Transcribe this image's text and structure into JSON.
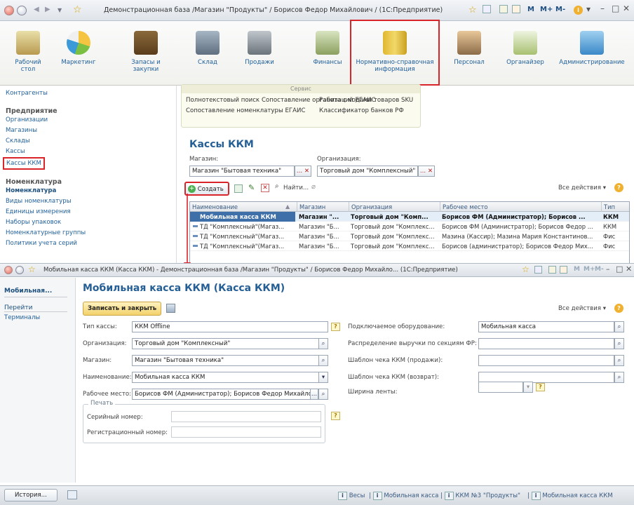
{
  "window": {
    "title": "Демонстрационная база /Магазин \"Продукты\" / Борисов Федор Михайлович /  (1С:Предприятие)",
    "memory_buttons": [
      "M",
      "M+",
      "M-"
    ]
  },
  "sections": [
    {
      "label": "Рабочий стол",
      "icon": "desktop-icon"
    },
    {
      "label": "Маркетинг",
      "icon": "marketing-pie-icon"
    },
    {
      "label": "Запасы и закупки",
      "icon": "warehouse-boxes-icon"
    },
    {
      "label": "Склад",
      "icon": "storage-icon"
    },
    {
      "label": "Продажи",
      "icon": "cash-register-icon"
    },
    {
      "label": "Финансы",
      "icon": "finance-money-icon"
    },
    {
      "label": "Нормативно-справочная информация",
      "icon": "reference-binders-icon"
    },
    {
      "label": "Персонал",
      "icon": "staff-icon"
    },
    {
      "label": "Органайзер",
      "icon": "organizer-checklist-icon"
    },
    {
      "label": "Администрирование",
      "icon": "admin-computer-icon"
    }
  ],
  "nav": {
    "counterparties": "Контрагенты",
    "enterprise_header": "Предприятие",
    "enterprise_items": [
      "Организации",
      "Магазины",
      "Склады",
      "Кассы",
      "Кассы ККМ"
    ],
    "nomenclature_header": "Номенклатура",
    "nomenclature_items": [
      "Номенклатура",
      "Виды номенклатуры",
      "Единицы измерения",
      "Наборы упаковок",
      "Номенклатурные группы",
      "Политики учета серий"
    ]
  },
  "service": {
    "header": "Сервис",
    "col1": [
      "Полнотекстовый поиск",
      "Сопоставление организаций ЕГАИС",
      "Сопоставление номенклатуры ЕГАИС"
    ],
    "col2": [
      "Работа с кодами товаров SKU",
      "Классификатор банков РФ"
    ]
  },
  "kassy": {
    "title": "Кассы ККМ",
    "store_label": "Магазин:",
    "store_value": "Магазин \"Бытовая техника\"",
    "org_label": "Организация:",
    "org_value": "Торговый дом \"Комплексный\"",
    "create_button": "Создать",
    "find_button": "Найти...",
    "all_actions": "Все действия",
    "columns": [
      "Наименование",
      "Магазин",
      "Организация",
      "Рабочее место",
      "Тип"
    ],
    "rows": [
      [
        "Мобильная касса ККМ",
        "Магазин \"...",
        "Торговый дом \"Комп...",
        "Борисов ФМ (Администратор); Борисов ...",
        "ККМ"
      ],
      [
        "ТД \"Комплексный\"(Магаз...",
        "Магазин \"Б...",
        "Торговый дом \"Комплекс...",
        "Борисов ФМ (Администратор); Борисов Федор ...",
        "ККМ"
      ],
      [
        "ТД \"Комплексный\"(Магаз...",
        "Магазин \"Б...",
        "Торговый дом \"Комплекс...",
        "Мазина (Кассир); Мазина Мария Константинов...",
        "Фис"
      ],
      [
        "ТД \"Комплексный\"(Магаз...",
        "Магазин \"Б...",
        "Торговый дом \"Комплекс...",
        "Борисов (администратор); Борисов Федор Мих...",
        "Фис"
      ]
    ]
  },
  "window2": {
    "title": "Мобильная касса ККМ (Касса ККМ) - Демонстрационная база /Магазин \"Продукты\" / Борисов Федор Михайло...  (1С:Предприятие)",
    "nav_title": "Мобильная...",
    "nav_goto": "Перейти",
    "nav_terminals": "Терминалы",
    "form_title": "Мобильная касса ККМ (Касса ККМ)",
    "save_close": "Записать и закрыть",
    "all_actions": "Все действия",
    "fields": {
      "type_label": "Тип кассы:",
      "type_value": "ККМ Offline",
      "org_label": "Организация:",
      "org_value": "Торговый дом \"Комплексный\"",
      "store_label": "Магазин:",
      "store_value": "Магазин \"Бытовая техника\"",
      "name_label": "Наименование:",
      "name_value": "Мобильная касса ККМ",
      "workplace_label": "Рабочее место:",
      "workplace_value": "Борисов ФМ (Администратор); Борисов Федор Михайло",
      "equipment_label": "Подключаемое оборудование:",
      "equipment_value": "Мобильная касса",
      "revenue_label": "Распределение выручки по секциям ФР:",
      "check_sale_label": "Шаблон чека ККМ (продажи):",
      "check_return_label": "Шаблон чека ККМ (возврат):",
      "tape_label": "Ширина ленты:",
      "print_group": "Печать",
      "serial_label": "Серийный номер:",
      "reg_label": "Регистрационный номер:"
    }
  },
  "statusbar": {
    "history": "История...",
    "items": [
      "Весы",
      "Мобильная касса",
      "ККМ №3 \"Продукты\"",
      "Мобильная касса ККМ"
    ]
  }
}
